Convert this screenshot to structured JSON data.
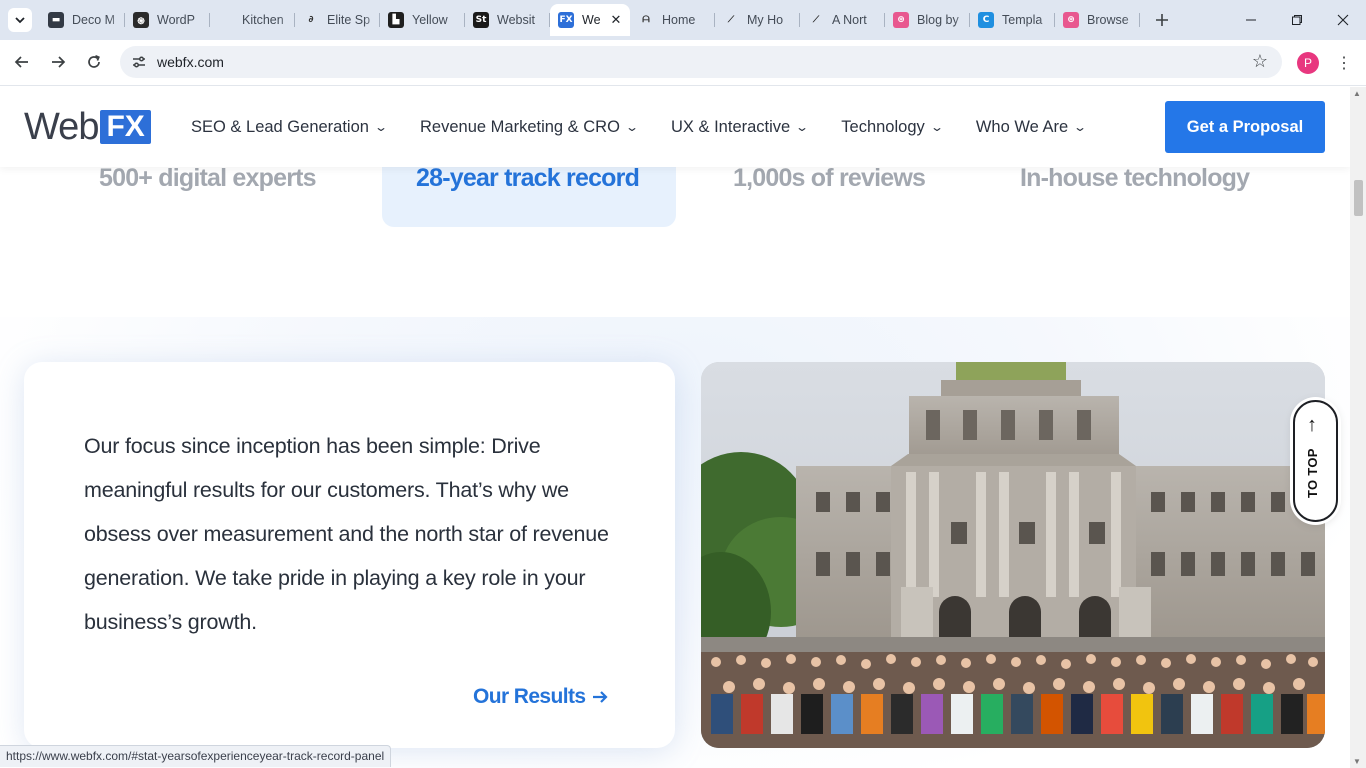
{
  "browser": {
    "tabs": [
      {
        "title": "Deco M",
        "favicon": "deco-icon",
        "color": "#333a45",
        "glyph": "▬"
      },
      {
        "title": "WordP",
        "favicon": "openai-icon",
        "color": "#2b2b2b",
        "glyph": "֍"
      },
      {
        "title": "Kitchen",
        "favicon": "blank-icon",
        "color": "#dfe6f1",
        "glyph": ""
      },
      {
        "title": "Elite Sp",
        "favicon": "link-icon",
        "color": "#dfe6f1",
        "glyph": "∂"
      },
      {
        "title": "Yellow",
        "favicon": "yellow-icon",
        "color": "#1f1f1f",
        "glyph": "▙"
      },
      {
        "title": "Websit",
        "favicon": "st-icon",
        "color": "#1a1a1a",
        "glyph": "St"
      },
      {
        "title": "We",
        "favicon": "webfx-icon",
        "color": "#2d6fd8",
        "glyph": "FX"
      },
      {
        "title": "Home",
        "favicon": "abm-icon",
        "color": "#dfe6f1",
        "glyph": "ᗩ"
      },
      {
        "title": "My Ho",
        "favicon": "node-icon",
        "color": "#dfe6f1",
        "glyph": "⟋"
      },
      {
        "title": "A Nort",
        "favicon": "node-icon",
        "color": "#dfe6f1",
        "glyph": "⟋"
      },
      {
        "title": "Blog by",
        "favicon": "dribbble-icon",
        "color": "#e8588f",
        "glyph": "⊛"
      },
      {
        "title": "Templa",
        "favicon": "canva-icon",
        "color": "#1f8fe0",
        "glyph": "C"
      },
      {
        "title": "Browse",
        "favicon": "dribbble-icon",
        "color": "#e8588f",
        "glyph": "⊛"
      }
    ],
    "active_tab_index": 6,
    "url": "webfx.com",
    "profile_initial": "P",
    "status_url": "https://www.webfx.com/#stat-yearsofexperienceyear-track-record-panel"
  },
  "header": {
    "logo_web": "Web",
    "logo_fx": "FX",
    "nav": [
      {
        "label": "SEO & Lead Generation"
      },
      {
        "label": "Revenue Marketing & CRO"
      },
      {
        "label": "UX & Interactive"
      },
      {
        "label": "Technology"
      },
      {
        "label": "Who We Are"
      }
    ],
    "cta_label": "Get a Proposal"
  },
  "stats": [
    {
      "label": "500+ digital experts",
      "active": false
    },
    {
      "label": "28-year track record",
      "active": true
    },
    {
      "label": "1,000s of reviews",
      "active": false
    },
    {
      "label": "In-house technology",
      "active": false
    }
  ],
  "panel": {
    "body": "Our focus since inception has been simple: Drive meaningful results for our customers. That’s why we obsess over measurement and the north star of revenue generation. We take pride in playing a key role in your business’s growth.",
    "link_label": "Our Results",
    "link_icon": "arrow-right-icon"
  },
  "to_top_label": "TO TOP",
  "colors": {
    "brand_blue": "#2477e8",
    "active_stat": "#2473d9",
    "inactive_stat": "#a3a8b0"
  }
}
